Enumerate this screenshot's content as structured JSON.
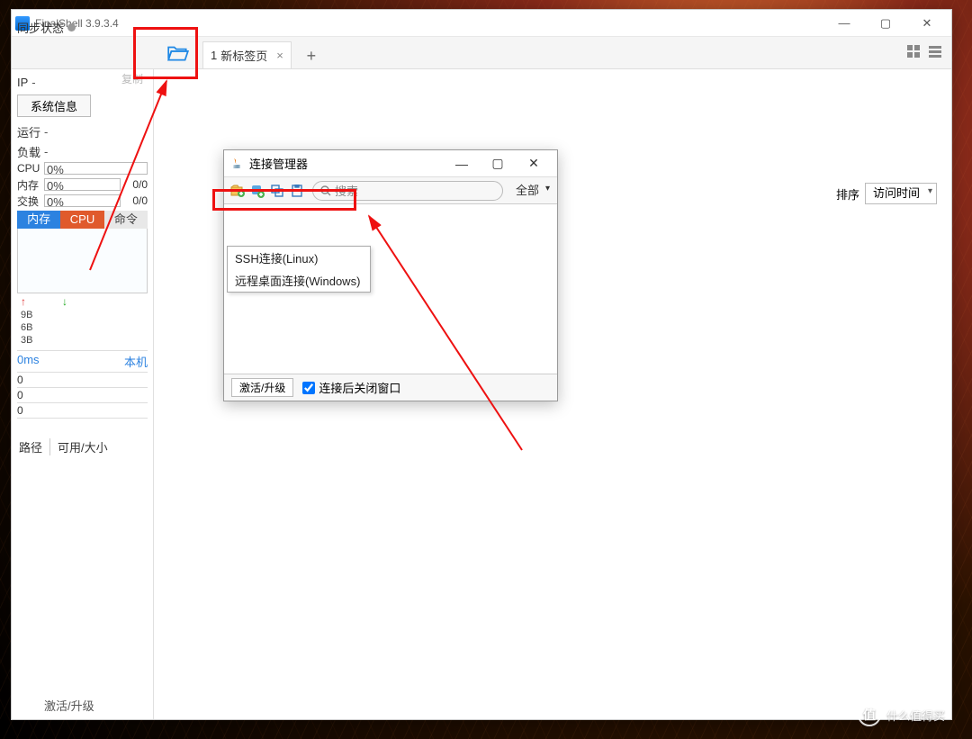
{
  "window": {
    "title": "FinalShell 3.9.3.4",
    "min": "—",
    "max": "▢",
    "close": "✕"
  },
  "tabs": {
    "num": "1",
    "label": "新标签页",
    "close": "×",
    "plus": "+"
  },
  "sidebar": {
    "sync": "同步状态",
    "ip": "IP",
    "ip_val": "-",
    "copy": "复制",
    "sysinfo": "系统信息",
    "run": "运行",
    "run_val": "-",
    "load": "负载",
    "load_val": "-",
    "cpu": "CPU",
    "cpu_val": "0%",
    "mem": "内存",
    "mem_val": "0%",
    "mem_r": "0/0",
    "swap": "交换",
    "swap_val": "0%",
    "swap_r": "0/0",
    "seg_mem": "内存",
    "seg_cpu": "CPU",
    "seg_cmd": "命令",
    "y_9b": "9B",
    "y_6b": "6B",
    "y_3b": "3B",
    "lat": "0ms",
    "host": "本机",
    "z0": "0",
    "path": "路径",
    "size": "可用/大小",
    "activate": "激活/升级"
  },
  "sort": {
    "label": "排序",
    "value": "访问时间"
  },
  "dialog": {
    "title": "连接管理器",
    "search_ph": "搜索",
    "filter": "全部",
    "menu_ssh": "SSH连接(Linux)",
    "menu_rdp": "远程桌面连接(Windows)",
    "activate": "激活/升级",
    "chk_label": "连接后关闭窗口"
  },
  "watermark": {
    "badge": "值",
    "text": "什么值得买"
  }
}
